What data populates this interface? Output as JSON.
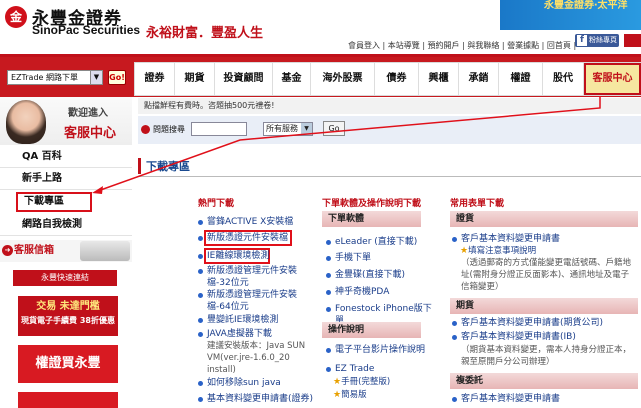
{
  "header": {
    "logo_mark": "金",
    "brand_cn": "永豐金證券",
    "brand_en": "SinoPac Securities",
    "slogan": "永裕財富．豐盈人生",
    "banner_text": "永豐金證券‧太平洋",
    "top_links": "會員登入 | 本站導覽 | 預約開戶 | 與我聯絡 | 營業據點 | 回首頁 |",
    "fb_label": "粉絲專頁"
  },
  "nav": {
    "select_value": "EZTrade 網路下單",
    "go_label": "Go!",
    "items": [
      "證券",
      "期貨",
      "投資顧問",
      "基金",
      "海外股票",
      "債券",
      "興櫃",
      "承銷",
      "權證",
      "股代"
    ],
    "active": "客服中心"
  },
  "sidebar": {
    "welcome": "歡迎進入",
    "title": "客服中心",
    "items": [
      "QA 百科",
      "新手上路",
      "下載專區",
      "網路自我檢測"
    ],
    "mailbox": "客服信箱",
    "quick": "永豐快速連結",
    "ad1_line1": "交易 未達門檻",
    "ad1_line2": "現貨電子手續費 38折優惠",
    "ad2": "權證買永豐"
  },
  "main": {
    "notice": "點擋鮮程有費時。咨題抽500元禮卷!",
    "question_label": "問題搜尋",
    "service_select": "所有服務",
    "go_label": "Go",
    "section_title": "下載專區",
    "col1": {
      "head": "熱門下載",
      "links": [
        "嘗鋒ACTIVE X安裝檔",
        "新版憑證元件安裝檔",
        "IE離線環境檢測",
        "新版憑證管理元件安裝檔-32位元",
        "新版憑證管理元件安裝檔-64位元",
        "豐變託IE環境檢測",
        "JAVA虛擬器下載",
        "如何移除sun java",
        "基本資料變更申請書(證券)"
      ],
      "java_note": "建議安裝版本：Java SUN VM(ver.jre-1.6.0_20 install)"
    },
    "col2": {
      "head": "下單軟體及操作說明下載",
      "box1": "下單軟體",
      "links1": [
        "eLeader (直接下載)",
        "手機下單",
        "金豐碟(直接下載)",
        "神乎奇機PDA",
        "Fonestock iPhone版下單"
      ],
      "box2": "操作說明",
      "links2": [
        "電子平台影片操作說明"
      ],
      "ez_title": "EZ Trade",
      "ez_sub": [
        "手冊(完整版)",
        "簡易版"
      ]
    },
    "col3": {
      "head": "常用表單下載",
      "box1": "證貨",
      "link1": "客戶基本資料變更申請書",
      "star1": "填寫注意事項說明",
      "note1": "（透過郵寄的方式僅能變更電話號碼、戶籍地址(需附身分證正反面影本)、通訊地址及電子信箱變更）",
      "box2": "期貨",
      "link2a": "客戶基本資料變更申請書(期貨公司)",
      "link2b": "客戶基本資料變更申請書(IB)",
      "note2": "（期貨基本資料變更，需本人持身分證正本，親至原開戶分公司辦理）",
      "box3": "複委託",
      "link3": "客戶基本資料變更申請書"
    }
  },
  "colors": {
    "brand_red": "#c7191f",
    "link_blue": "#1a3d8a",
    "highlight_red": "#e0101a"
  }
}
